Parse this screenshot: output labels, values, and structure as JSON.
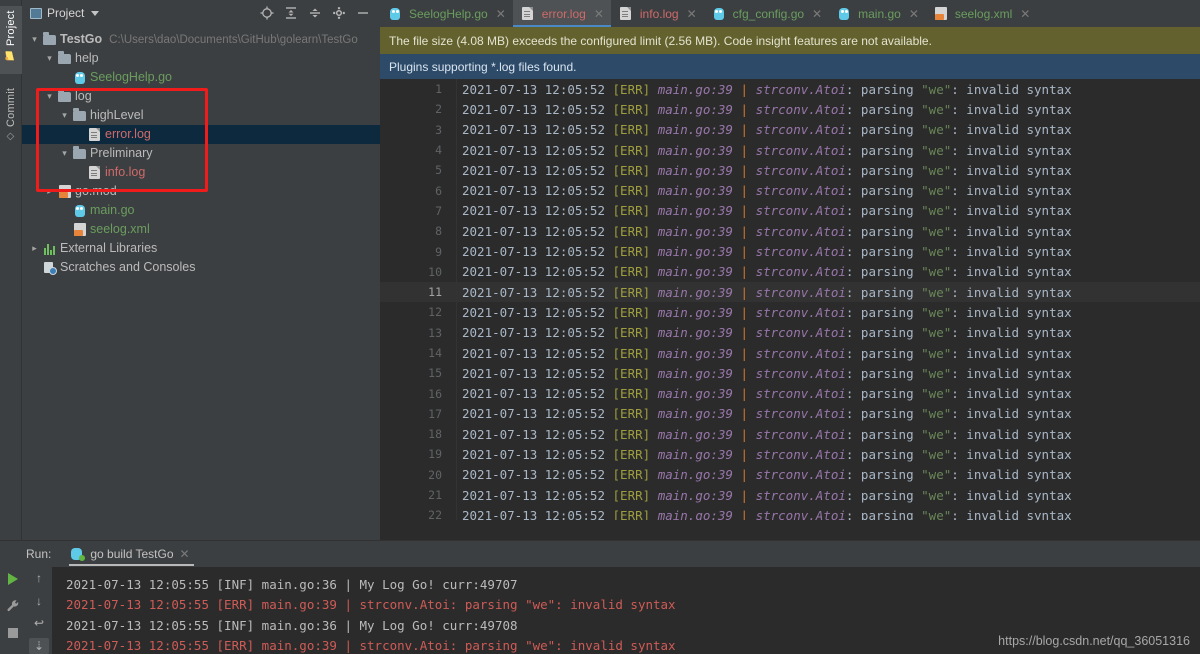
{
  "left_strip": {
    "items": [
      {
        "label": "Project",
        "icon": "folder-icon",
        "selected": true
      },
      {
        "label": "Commit",
        "icon": "commit-icon",
        "selected": false
      }
    ]
  },
  "project_panel": {
    "title": "Project",
    "dropdown_icon": "chevron-down-icon",
    "toolbar": [
      {
        "name": "locate-icon",
        "glyph": "⊕"
      },
      {
        "name": "expand-all-icon",
        "glyph": "≣"
      },
      {
        "name": "collapse-all-icon",
        "glyph": "≡"
      },
      {
        "name": "gear-icon",
        "glyph": "⚙"
      },
      {
        "name": "minimize-icon",
        "glyph": "—"
      }
    ],
    "tree": [
      {
        "label": "TestGo",
        "path": "C:\\Users\\dao\\Documents\\GitHub\\golearn\\TestGo",
        "indent": 0,
        "arrow": "expanded",
        "icon": "folder-icon",
        "color": "#bbbbbb",
        "bold": true
      },
      {
        "label": "help",
        "path": "",
        "indent": 1,
        "arrow": "expanded",
        "icon": "folder-icon",
        "color": "#bbbbbb",
        "bold": false
      },
      {
        "label": "SeelogHelp.go",
        "path": "",
        "indent": 2,
        "arrow": "none",
        "icon": "go-file-icon",
        "color": "#6a9d5e",
        "bold": false
      },
      {
        "label": "log",
        "path": "",
        "indent": 1,
        "arrow": "expanded",
        "icon": "folder-icon",
        "color": "#bbbbbb",
        "bold": false
      },
      {
        "label": "highLevel",
        "path": "",
        "indent": 2,
        "arrow": "expanded",
        "icon": "folder-icon",
        "color": "#bbbbbb",
        "bold": false
      },
      {
        "label": "error.log",
        "path": "",
        "indent": 3,
        "arrow": "none",
        "icon": "log-file-icon",
        "color": "#cf6a6a",
        "bold": false,
        "selected": true
      },
      {
        "label": "Preliminary",
        "path": "",
        "indent": 2,
        "arrow": "expanded",
        "icon": "folder-icon",
        "color": "#bbbbbb",
        "bold": false
      },
      {
        "label": "info.log",
        "path": "",
        "indent": 3,
        "arrow": "none",
        "icon": "log-file-icon",
        "color": "#cf6a6a",
        "bold": false
      },
      {
        "label": "go.mod",
        "path": "",
        "indent": 1,
        "arrow": "collapsed",
        "icon": "mod-file-icon",
        "color": "#bbbbbb",
        "bold": false
      },
      {
        "label": "main.go",
        "path": "",
        "indent": 2,
        "arrow": "none",
        "icon": "go-file-icon",
        "color": "#6a9d5e",
        "bold": false
      },
      {
        "label": "seelog.xml",
        "path": "",
        "indent": 2,
        "arrow": "none",
        "icon": "xml-file-icon",
        "color": "#6a9d5e",
        "bold": false
      },
      {
        "label": "External Libraries",
        "path": "",
        "indent": 0,
        "arrow": "collapsed",
        "icon": "library-icon",
        "color": "#bbbbbb",
        "bold": false
      },
      {
        "label": "Scratches and Consoles",
        "path": "",
        "indent": 0,
        "arrow": "none",
        "icon": "scratches-icon",
        "color": "#bbbbbb",
        "bold": false
      }
    ],
    "annotation_color": "#f01c1c"
  },
  "editor": {
    "tabs": [
      {
        "label": "SeelogHelp.go",
        "icon": "go-file-icon",
        "color": "#6a9d5e",
        "active": false,
        "close_icon": "close-icon"
      },
      {
        "label": "error.log",
        "icon": "log-file-icon",
        "color": "#cf6a6a",
        "active": true,
        "close_icon": "close-icon"
      },
      {
        "label": "info.log",
        "icon": "log-file-icon",
        "color": "#cf6a6a",
        "active": false,
        "close_icon": "close-icon"
      },
      {
        "label": "cfg_config.go",
        "icon": "go-file-icon",
        "color": "#6a9d5e",
        "active": false,
        "close_icon": "close-icon"
      },
      {
        "label": "main.go",
        "icon": "go-file-icon",
        "color": "#6a9d5e",
        "active": false,
        "close_icon": "close-icon"
      },
      {
        "label": "seelog.xml",
        "icon": "xml-file-icon",
        "color": "#6a9d5e",
        "active": false,
        "close_icon": "close-icon"
      }
    ],
    "notice_warning": "The file size (4.08 MB) exceeds the configured limit (2.56 MB). Code insight features are not available.",
    "notice_info": "Plugins supporting *.log files found.",
    "current_line": 11,
    "line_template": {
      "timestamp": "2021-07-13 12:05:52",
      "level": "[ERR]",
      "location": "main.go:39",
      "separator": "|",
      "func": "strconv.Atoi",
      "colon": ":",
      "verb": " parsing ",
      "string": "\"we\"",
      "tail": ": invalid syntax"
    },
    "line_numbers": [
      1,
      2,
      3,
      4,
      5,
      6,
      7,
      8,
      9,
      10,
      11,
      12,
      13,
      14,
      15,
      16,
      17,
      18,
      19,
      20,
      21,
      22
    ],
    "colors": {
      "timestamp": "#a9b7c6",
      "level": "#9e9e3f",
      "location": "#9876aa",
      "separator": "#cc7832",
      "string": "#6a8759",
      "text": "#a9b7c6"
    }
  },
  "run_panel": {
    "label": "Run:",
    "tab_label": "go build TestGo",
    "tab_close_icon": "close-icon",
    "tab_icon": "go-build-icon",
    "left_buttons": [
      {
        "name": "rerun-button",
        "icon": "play-icon"
      },
      {
        "name": "settings-button",
        "icon": "wrench-icon"
      },
      {
        "name": "stop-button",
        "icon": "stop-icon"
      }
    ],
    "right_buttons": [
      {
        "name": "prev-occurrence-button",
        "icon": "arrow-up-icon",
        "glyph": "↑"
      },
      {
        "name": "next-occurrence-button",
        "icon": "arrow-down-icon",
        "glyph": "↓"
      },
      {
        "name": "soft-wrap-button",
        "icon": "soft-wrap-icon",
        "glyph": "↩"
      },
      {
        "name": "scroll-to-end-button",
        "icon": "scroll-end-icon",
        "glyph": "⇣",
        "active": true
      }
    ],
    "lines": [
      {
        "text": "2021-07-13 12:05:55 [INF] main.go:36 | My Log Go! curr:49707",
        "type": "info"
      },
      {
        "text": "2021-07-13 12:05:55 [ERR] main.go:39 | strconv.Atoi: parsing \"we\": invalid syntax",
        "type": "error"
      },
      {
        "text": "2021-07-13 12:05:55 [INF] main.go:36 | My Log Go! curr:49708",
        "type": "info"
      },
      {
        "text": "2021-07-13 12:05:55 [ERR] main.go:39 | strconv.Atoi: parsing \"we\": invalid syntax",
        "type": "error"
      }
    ]
  },
  "watermark": "https://blog.csdn.net/qq_36051316"
}
